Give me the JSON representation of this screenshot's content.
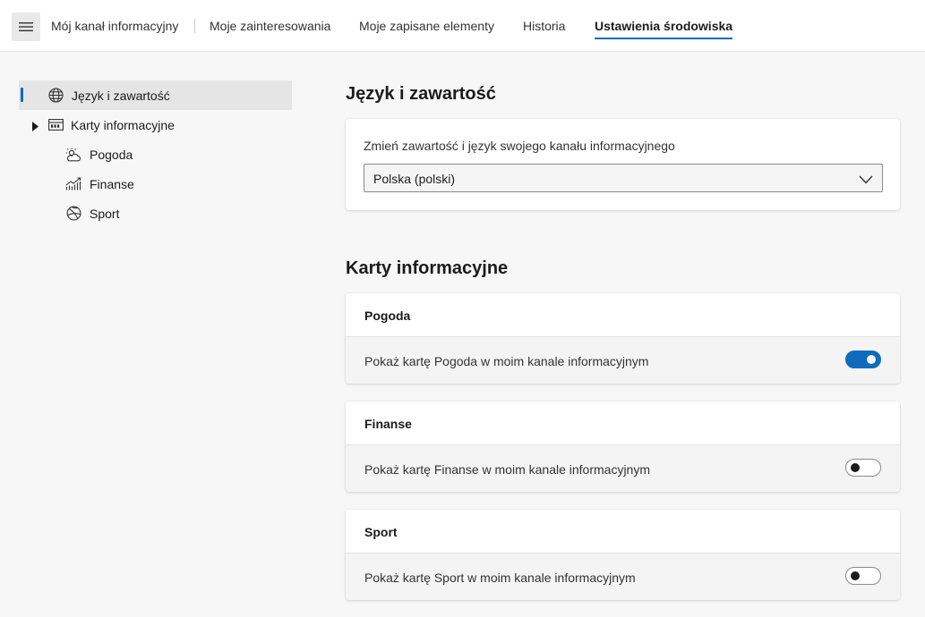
{
  "topnav": {
    "menu_icon": "hamburger-icon",
    "tabs": [
      {
        "label": "Mój kanał informacyjny"
      },
      {
        "label": "Moje zainteresowania"
      },
      {
        "label": "Moje zapisane elementy"
      },
      {
        "label": "Historia"
      },
      {
        "label": "Ustawienia środowiska",
        "active": true
      }
    ]
  },
  "sidebar": {
    "items": [
      {
        "label": "Język i zawartość",
        "icon": "globe-icon",
        "active": true
      },
      {
        "label": "Karty informacyjne",
        "icon": "cards-icon",
        "expander": "caret-right-icon"
      },
      {
        "label": "Pogoda",
        "icon": "weather-icon"
      },
      {
        "label": "Finanse",
        "icon": "finance-chart-icon"
      },
      {
        "label": "Sport",
        "icon": "sports-ball-icon"
      }
    ]
  },
  "language_section": {
    "title": "Język i zawartość",
    "label": "Zmień zawartość i język swojego kanału informacyjnego",
    "selected": "Polska (polski)"
  },
  "cards_section": {
    "title": "Karty informacyjne",
    "cards": [
      {
        "title": "Pogoda",
        "text": "Pokaż kartę Pogoda w moim kanale informacyjnym",
        "enabled": true
      },
      {
        "title": "Finanse",
        "text": "Pokaż kartę Finanse w moim kanale informacyjnym",
        "enabled": false
      },
      {
        "title": "Sport",
        "text": "Pokaż kartę Sport w moim kanale informacyjnym",
        "enabled": false
      }
    ]
  },
  "colors": {
    "accent": "#0f6cbd",
    "background": "#f7f7f7",
    "card": "#ffffff"
  }
}
